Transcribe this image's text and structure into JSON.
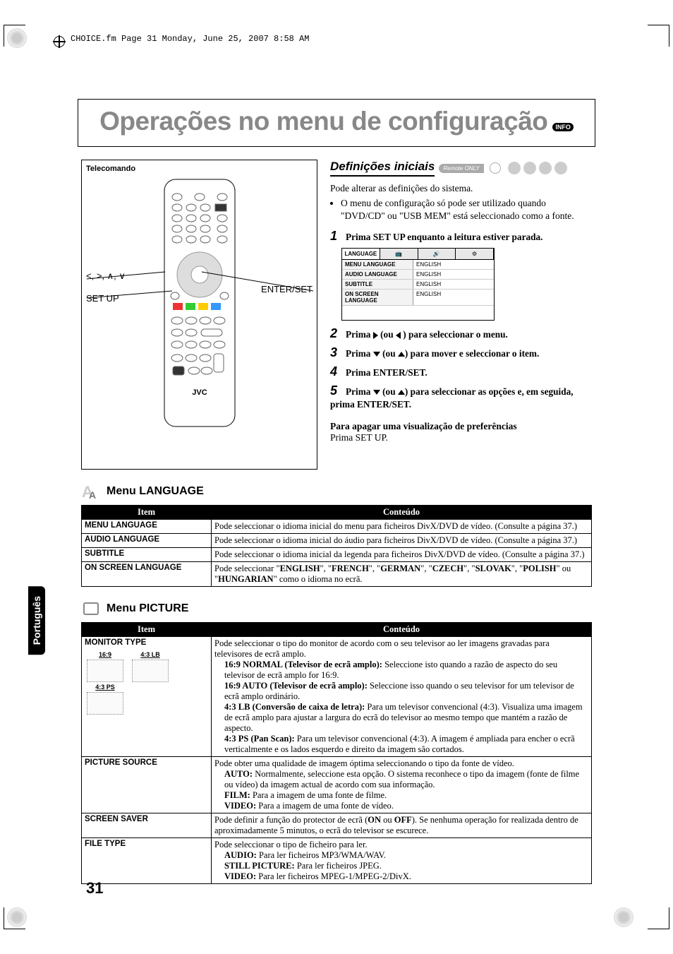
{
  "doc_header": "CHOICE.fm  Page 31  Monday, June 25, 2007  8:58 AM",
  "title": "Operações no menu de configuração",
  "info_badge": "INFO",
  "remote": {
    "box_label": "Telecomando",
    "brand": "JVC",
    "label_arrows": "<, >, ∧, ∨",
    "label_setup": "SET UP",
    "label_enter": "ENTER/SET"
  },
  "defs": {
    "heading": "Definições iniciais",
    "remote_only": "Remote ONLY",
    "intro": "Pode alterar as definições do sistema.",
    "bullet1": "O menu de configuração só pode ser utilizado quando \"DVD/CD\" ou \"USB MEM\" está seleccionado como a fonte.",
    "steps": [
      "Prima SET UP enquanto a leitura estiver parada.",
      "Prima > (ou < ) para seleccionar o menu.",
      "Prima ∨ (ou ∧) para mover e seleccionar o item.",
      "Prima ENTER/SET.",
      "Prima ∨ (ou ∧) para seleccionar as opções e, em seguida, prima ENTER/SET."
    ],
    "erase_title": "Para apagar uma visualização de preferências",
    "erase_body": "Prima SET UP."
  },
  "setup_screen": {
    "tab": "LANGUAGE",
    "rows": [
      {
        "k": "MENU LANGUAGE",
        "v": "ENGLISH"
      },
      {
        "k": "AUDIO LANGUAGE",
        "v": "ENGLISH"
      },
      {
        "k": "SUBTITLE",
        "v": "ENGLISH"
      },
      {
        "k": "ON SCREEN LANGUAGE",
        "v": "ENGLISH"
      }
    ]
  },
  "menu_lang": {
    "heading_prefix": "Menu ",
    "heading_main": "LANGUAGE",
    "th_item": "Item",
    "th_content": "Conteúdo",
    "rows": [
      {
        "item": "MENU LANGUAGE",
        "content": "Pode seleccionar o idioma inicial do menu para ficheiros DivX/DVD de vídeo. (Consulte a página 37.)"
      },
      {
        "item": "AUDIO LANGUAGE",
        "content": "Pode seleccionar o idioma inicial do áudio para ficheiros DivX/DVD de vídeo. (Consulte a página 37.)"
      },
      {
        "item": "SUBTITLE",
        "content": "Pode seleccionar o idioma inicial da legenda para ficheiros DivX/DVD de vídeo. (Consulte a página 37.)"
      },
      {
        "item": "ON SCREEN LANGUAGE",
        "content": "Pode seleccionar \"ENGLISH\", \"FRENCH\", \"GERMAN\", \"CZECH\", \"SLOVAK\", \"POLISH\" ou \"HUNGARIAN\" como o idioma no ecrã."
      }
    ]
  },
  "menu_pic": {
    "heading_prefix": "Menu ",
    "heading_main": "PICTURE",
    "th_item": "Item",
    "th_content": "Conteúdo",
    "monitor": {
      "item": "MONITOR TYPE",
      "labels": {
        "w": "16:9",
        "lb": "4:3 LB",
        "ps": "4:3 PS"
      },
      "intro": "Pode seleccionar o tipo do monitor de acordo com o seu televisor ao ler imagens gravadas para televisores de ecrã amplo.",
      "n169_b": "16:9 NORMAL (Televisor de ecrã amplo): ",
      "n169_t": "Seleccione isto quando a razão de aspecto do seu televisor de ecrã amplo for 16:9.",
      "a169_b": "16:9 AUTO (Televisor de ecrã amplo): ",
      "a169_t": "Seleccione isso quando o seu televisor for um televisor de ecrã amplo ordinário.",
      "lb_b": "4:3 LB (Conversão de caixa de letra): ",
      "lb_t": "Para um televisor convencional (4:3). Visualiza uma imagem de ecrã amplo para ajustar a largura do ecrã do televisor ao mesmo tempo que mantém a razão de aspecto.",
      "ps_b": "4:3 PS (Pan Scan): ",
      "ps_t": "Para um televisor convencional (4:3). A imagem é ampliada para encher o ecrã verticalmente e os lados esquerdo e direito da imagem são cortados."
    },
    "src": {
      "item": "PICTURE SOURCE",
      "l1": "Pode obter uma qualidade de imagem óptima seleccionando o tipo da fonte de vídeo.",
      "auto_b": "AUTO: ",
      "auto_t": "Normalmente, seleccione esta opção. O sistema reconhece o tipo da imagem (fonte de filme ou vídeo) da imagem actual de acordo com sua informação.",
      "film_b": "FILM: ",
      "film_t": "Para a imagem de uma fonte de filme.",
      "video_b": "VIDEO: ",
      "video_t": "Para a imagem de uma fonte de vídeo."
    },
    "ssaver": {
      "item": "SCREEN SAVER",
      "text_pre": "Pode definir a função do protector de ecrã (",
      "on": "ON",
      "or": " ou ",
      "off": "OFF",
      "text_post": "). Se nenhuma operação for realizada dentro de aproximadamente 5 minutos, o ecrã do televisor se escurece."
    },
    "ftype": {
      "item": "FILE TYPE",
      "l1": "Pode seleccionar o tipo de ficheiro para ler.",
      "audio_b": "AUDIO: ",
      "audio_t": "Para ler ficheiros MP3/WMA/WAV.",
      "still_b": "STILL PICTURE: ",
      "still_t": "Para ler ficheiros JPEG.",
      "video_b": "VIDEO: ",
      "video_t": "Para ler ficheiros MPEG-1/MPEG-2/DivX."
    }
  },
  "side_tab": "Português",
  "page_number": "31"
}
